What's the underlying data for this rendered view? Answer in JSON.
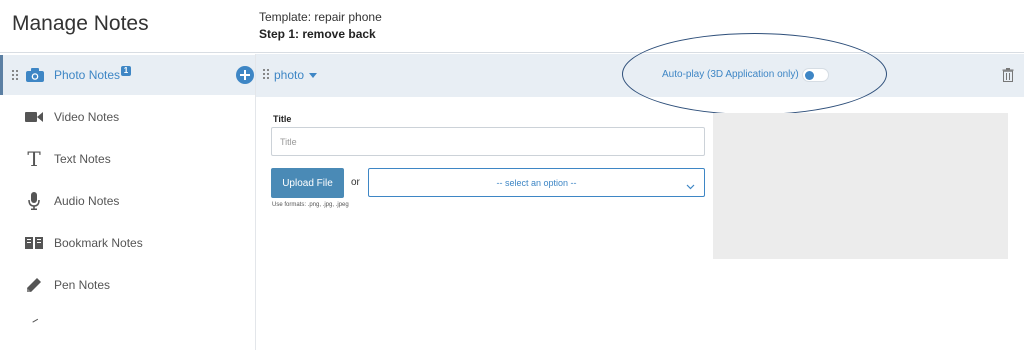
{
  "header": {
    "app_title": "Manage Notes",
    "template": "Template: repair phone",
    "step": "Step 1: remove back"
  },
  "sidebar": {
    "items": [
      {
        "label": "Photo Notes",
        "icon": "camera-icon",
        "active": true,
        "badge": "1"
      },
      {
        "label": "Video Notes",
        "icon": "video-camera-icon"
      },
      {
        "label": "Text Notes",
        "icon": "text-t-icon"
      },
      {
        "label": "Audio Notes",
        "icon": "microphone-icon"
      },
      {
        "label": "Bookmark Notes",
        "icon": "book-icon"
      },
      {
        "label": "Pen Notes",
        "icon": "pencil-icon"
      }
    ]
  },
  "toolbar": {
    "type_select": "photo",
    "autoplay_label": "Auto-play (3D Application only)",
    "autoplay_enabled": true
  },
  "form": {
    "title_label": "Title",
    "title_placeholder": "Title",
    "title_value": "",
    "upload_label": "Upload File",
    "or_text": "or",
    "select_value": "-- select an option --",
    "formats_hint": "Use formats: .png, .jpg, .jpeg"
  },
  "colors": {
    "accent": "#3e86c5",
    "active_bg": "#e8eef4",
    "annotation_ellipse": "#2e4f7a"
  }
}
